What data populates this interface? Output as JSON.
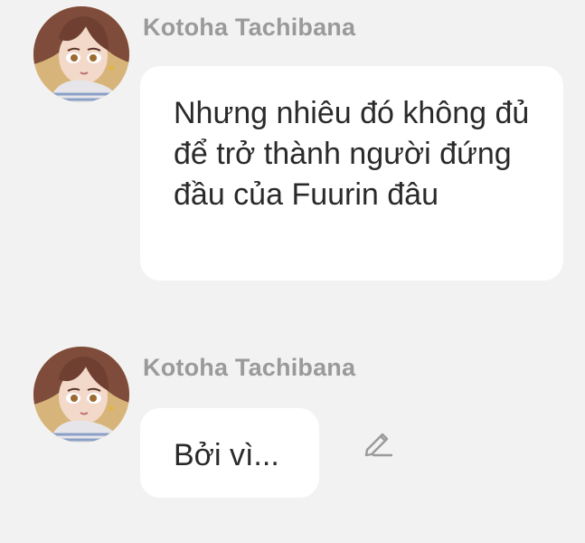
{
  "messages": [
    {
      "sender": "Kotoha Tachibana",
      "text": "Nhưng nhiêu đó không đủ để trở thành người đứng đầu của Fuurin đâu",
      "avatar_icon": "user-avatar"
    },
    {
      "sender": "Kotoha Tachibana",
      "text": "Bởi vì...",
      "avatar_icon": "user-avatar",
      "action_icon": "pencil-edit-icon"
    }
  ],
  "colors": {
    "background": "#f2f2f2",
    "bubble": "#ffffff",
    "sender_name": "#9a9a9a",
    "message_text": "#2a2a2a",
    "edit_icon": "#9a9a9a"
  }
}
